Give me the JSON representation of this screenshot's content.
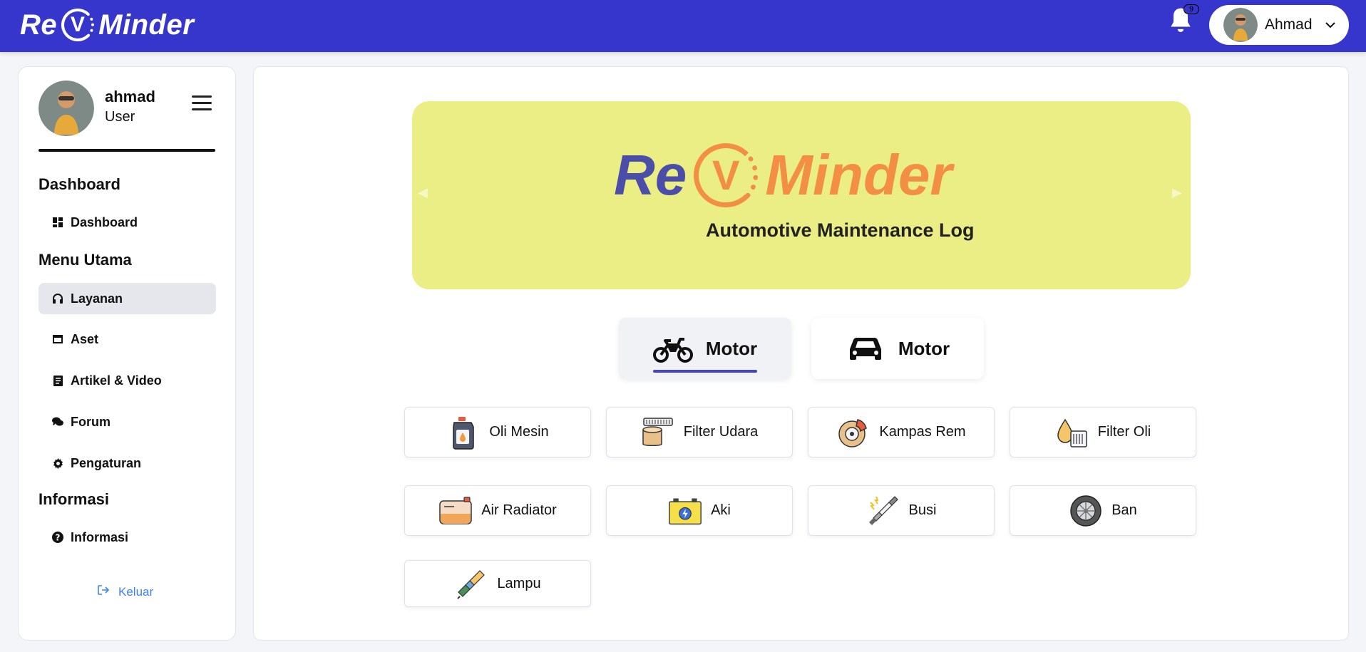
{
  "brand": {
    "left": "Re",
    "v": "V",
    "right": "Minder"
  },
  "notifications": {
    "count": "9"
  },
  "user_menu": {
    "name": "Ahmad"
  },
  "sidebar": {
    "profile": {
      "name": "ahmad",
      "role": "User"
    },
    "sections": {
      "dashboard": "Dashboard",
      "menu_utama": "Menu Utama",
      "informasi": "Informasi"
    },
    "items": [
      {
        "label": "Dashboard",
        "icon": "dashboard-icon"
      },
      {
        "label": "Layanan",
        "icon": "headphones-icon",
        "active": true
      },
      {
        "label": "Aset",
        "icon": "window-icon"
      },
      {
        "label": "Artikel & Video",
        "icon": "article-icon"
      },
      {
        "label": "Forum",
        "icon": "chat-icon"
      },
      {
        "label": "Pengaturan",
        "icon": "gear-icon"
      },
      {
        "label": "Informasi",
        "icon": "question-circle-icon"
      }
    ],
    "logout_label": "Keluar"
  },
  "banner": {
    "logo_left": "Re",
    "logo_v": "V",
    "logo_right": "Minder",
    "subtitle": "Automotive Maintenance Log",
    "colors": {
      "background": "#ebed85",
      "re": "#4a4ea8",
      "minder": "#f28f45"
    }
  },
  "vehicle_tabs": [
    {
      "label": "Motor",
      "icon": "motorcycle-icon",
      "active": true
    },
    {
      "label": "Motor",
      "icon": "car-icon",
      "active": false
    }
  ],
  "services": [
    {
      "label": "Oli Mesin",
      "icon": "oil-bottle-icon"
    },
    {
      "label": "Filter Udara",
      "icon": "air-filter-icon"
    },
    {
      "label": "Kampas Rem",
      "icon": "brake-icon"
    },
    {
      "label": "Filter Oli",
      "icon": "oil-filter-icon"
    },
    {
      "label": "Air Radiator",
      "icon": "radiator-icon"
    },
    {
      "label": "Aki",
      "icon": "battery-icon"
    },
    {
      "label": "Busi",
      "icon": "spark-plug-icon"
    },
    {
      "label": "Ban",
      "icon": "tire-icon"
    },
    {
      "label": "Lampu",
      "icon": "lamp-icon"
    }
  ],
  "colors": {
    "topbar": "#3636cc",
    "accent": "#4246c8",
    "logout": "#3b82f6"
  }
}
